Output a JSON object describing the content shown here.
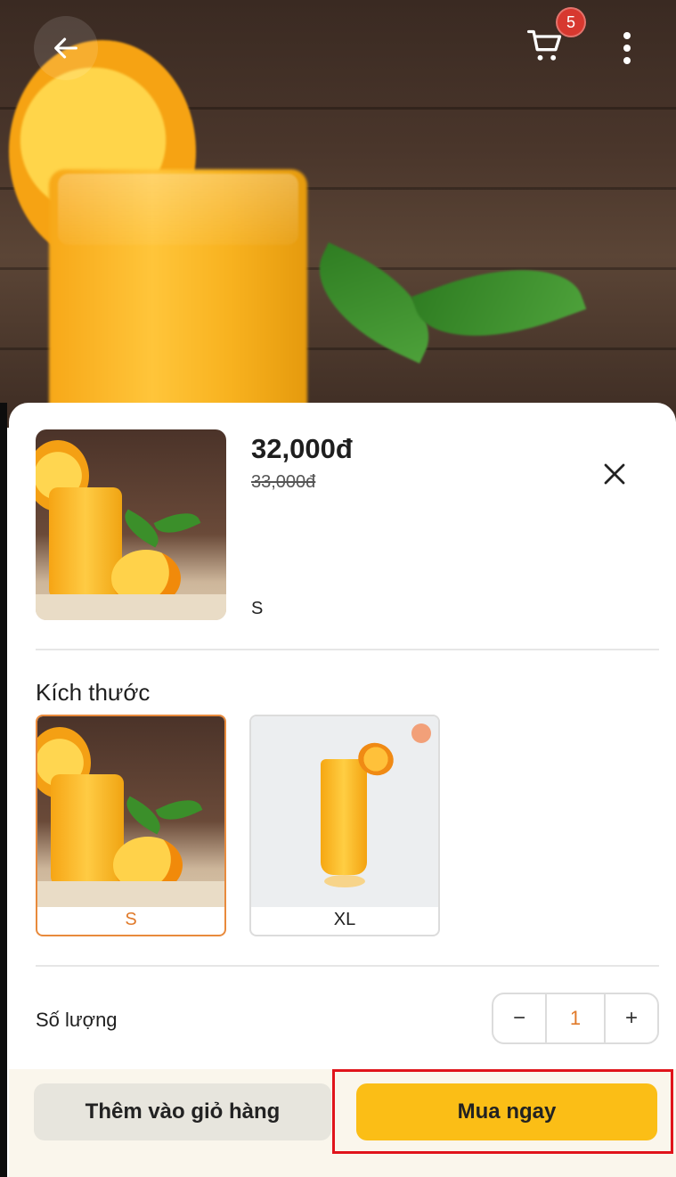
{
  "header": {
    "back_icon": "arrow-left-icon",
    "cart_icon": "shopping-cart-icon",
    "cart_badge": "5",
    "more_icon": "more-vertical-icon"
  },
  "product": {
    "price": "32,000đ",
    "old_price": "33,000đ",
    "selected_size": "S",
    "close_icon": "close-icon"
  },
  "size_section": {
    "title": "Kích thước",
    "options": [
      {
        "label": "S",
        "selected": true
      },
      {
        "label": "XL",
        "selected": false
      }
    ]
  },
  "quantity": {
    "label": "Số lượng",
    "value": "1",
    "decrement": "−",
    "increment": "+"
  },
  "actions": {
    "add_to_cart": "Thêm vào giỏ hàng",
    "buy_now": "Mua ngay"
  },
  "colors": {
    "accent": "#fbbe16",
    "selected_border": "#e88a3c",
    "badge": "#d7382f",
    "highlight": "#e0141b"
  }
}
